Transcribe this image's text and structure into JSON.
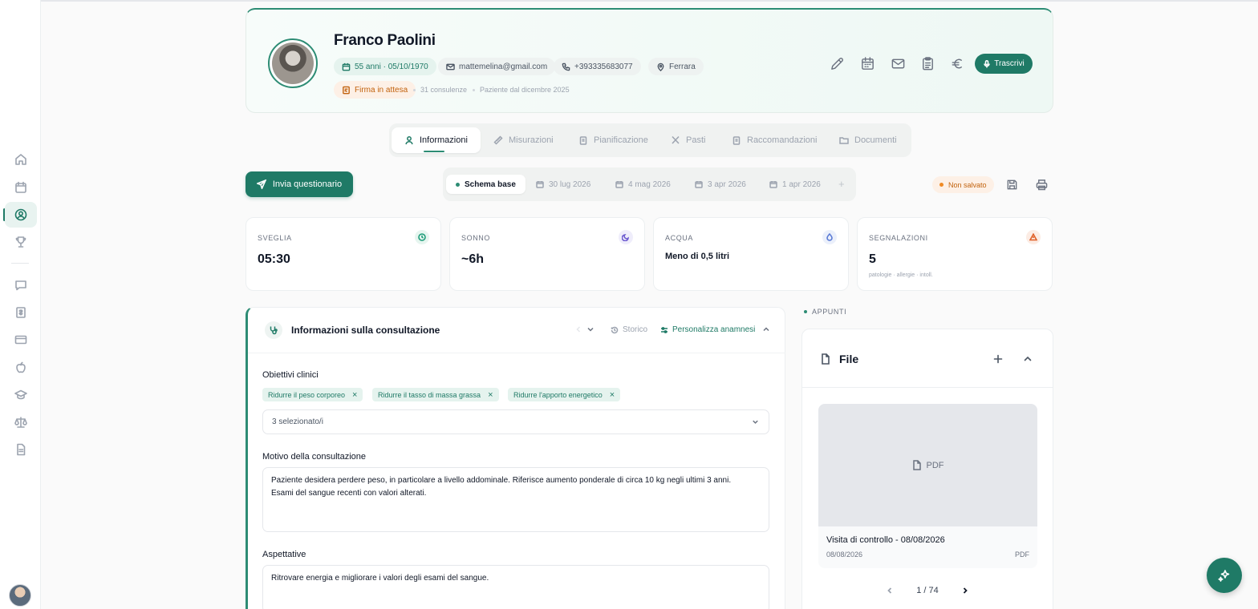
{
  "patient": {
    "name": "Franco Paolini",
    "age_birth": "55 anni · 05/10/1970",
    "email": "mattemelina@gmail.com",
    "phone": "+393335683077",
    "city": "Ferrara",
    "signature_status": "Firma in attesa",
    "consultations": "31 consulenze",
    "since": "Paziente dal dicembre 2025"
  },
  "header_actions": {
    "icons": [
      "pencil-icon",
      "calendar-icon",
      "mail-icon",
      "clipboard-icon",
      "euro-icon"
    ],
    "transcribe_label": "Trascrivi"
  },
  "tabs": [
    {
      "label": "Informazioni",
      "icon": "user-icon",
      "active": true
    },
    {
      "label": "Misurazioni",
      "icon": "ruler-icon"
    },
    {
      "label": "Pianificazione",
      "icon": "clipboard-icon"
    },
    {
      "label": "Pasti",
      "icon": "utensils-icon"
    },
    {
      "label": "Raccomandazioni",
      "icon": "clipboard-icon"
    },
    {
      "label": "Documenti",
      "icon": "folder-icon"
    }
  ],
  "toolbar": {
    "send_questionnaire": "Invia questionario",
    "schemas": [
      "Schema base",
      "30 lug 2026",
      "4 mag 2026",
      "3 apr 2026",
      "1 apr 2026"
    ],
    "add_symbol": "+",
    "unsaved_label": "Non salvato"
  },
  "stats": [
    {
      "label": "SVEGLIA",
      "value": "05:30",
      "icon": "clock-icon",
      "color": "#1f9d7a"
    },
    {
      "label": "SONNO",
      "value": "~6h",
      "icon": "moon-icon",
      "color": "#6d5bd0"
    },
    {
      "label": "ACQUA",
      "value": "Meno di 0,5 litri",
      "icon": "water-icon",
      "color": "#5b7bd5"
    },
    {
      "label": "SEGNALAZIONI",
      "value": "5",
      "sub": "patologie · allergie · intoll.",
      "icon": "alert-icon",
      "color": "#e0622b"
    }
  ],
  "consultation": {
    "title": "Informazioni sulla consultazione",
    "history_label": "Storico",
    "customize_label": "Personalizza anamnesi",
    "objectives_label": "Obiettivi clinici",
    "objectives": [
      "Ridurre il peso corporeo",
      "Ridurre il tasso di massa grassa",
      "Ridurre l'apporto energetico"
    ],
    "objectives_selected": "3 selezionato/i",
    "reason_label": "Motivo della consultazione",
    "reason_text": "Paziente desidera perdere peso, in particolare a livello addominale. Riferisce aumento ponderale di circa 10 kg negli ultimi 3 anni.\nEsami del sangue recenti con valori alterati.",
    "expectations_label": "Aspettative",
    "expectations_text": "Ritrovare energia e migliorare i valori degli esami del sangue."
  },
  "notes": {
    "section_label": "APPUNTI",
    "file_title": "File",
    "file_name": "Visita di controllo - 08/08/2026",
    "file_date": "08/08/2026",
    "file_type": "PDF",
    "thumb_label": "PDF",
    "pagination": "1 / 74"
  },
  "colors": {
    "accent": "#1f7a66",
    "warning": "#c2620d"
  }
}
